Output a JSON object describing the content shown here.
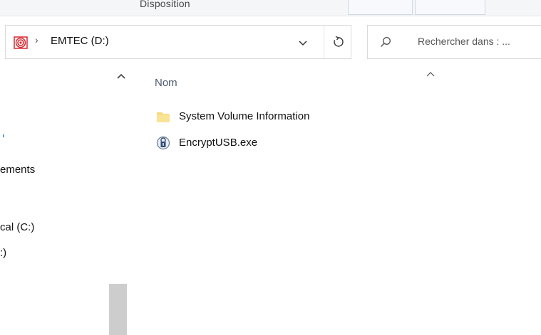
{
  "ribbon": {
    "group_label": "Disposition"
  },
  "address_bar": {
    "path_chevron": "›",
    "current_location": "EMTEC (D:)"
  },
  "search": {
    "placeholder": "Rechercher dans : ..."
  },
  "nav_pane": {
    "items": [
      {
        "label": "ements"
      },
      {
        "label": "cal (C:)"
      },
      {
        "label": ":)"
      }
    ]
  },
  "content": {
    "column_header": "Nom",
    "files": [
      {
        "name": "System Volume Information",
        "icon": "folder-icon"
      },
      {
        "name": "EncryptUSB.exe",
        "icon": "encrypt-lock-icon"
      }
    ]
  },
  "colors": {
    "folder": "#f8d775",
    "drive_icon": "#d8282f",
    "header_text": "#4a5a6e",
    "scroll_thumb": "#cdcdcd"
  }
}
